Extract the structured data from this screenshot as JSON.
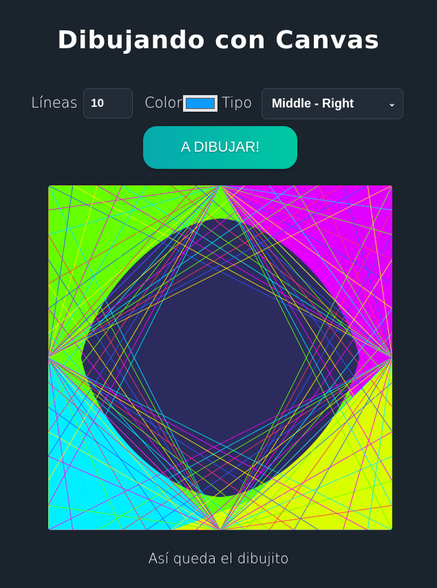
{
  "title": "Dibujando con Canvas",
  "controls": {
    "lines_label": "Líneas",
    "lines_value": "10",
    "color_label": "Color",
    "color_value": "#0d9bff",
    "type_label": "Tipo",
    "type_selected": "Middle - Right"
  },
  "button": {
    "label": "A DIBUJAR!"
  },
  "caption": "Así queda el dibujito",
  "canvas": {
    "background": "#2b2b5e",
    "fill_colors": [
      "#66ff00",
      "#e000ff",
      "#00f0ff",
      "#d8ff00"
    ]
  }
}
